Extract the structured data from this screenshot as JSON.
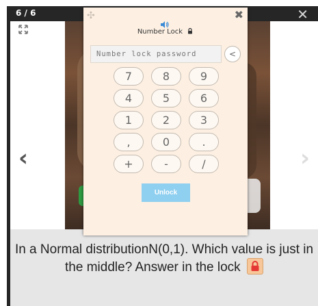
{
  "viewer": {
    "counter": "6 / 6",
    "close_glyph": "✕",
    "prev_glyph": "‹",
    "next_glyph": "›"
  },
  "caption": {
    "text": "In a Normal distributionN(0,1). Which value is just in the middle? Answer in the lock"
  },
  "lock_panel": {
    "title": "Number Lock",
    "move_glyph": "✣",
    "close_glyph": "✖",
    "password_placeholder": "Number lock password",
    "backspace_label": "<",
    "keys": [
      "7",
      "8",
      "9",
      "4",
      "5",
      "6",
      "1",
      "2",
      "3",
      ",",
      "0",
      ".",
      "+",
      "-",
      "/"
    ],
    "unlock_label": "Unlock"
  },
  "colors": {
    "panel_bg": "#fdf0e3",
    "unlock_bg": "#8fcff0",
    "viewer_bg": "#262626",
    "caption_bg": "#e6e6e6",
    "lock_icon": "#e53935"
  },
  "icons": [
    "fullscreen-icon",
    "speaker-icon",
    "lock-icon",
    "move-icon",
    "close-icon",
    "arrow-left-icon",
    "arrow-right-icon"
  ]
}
